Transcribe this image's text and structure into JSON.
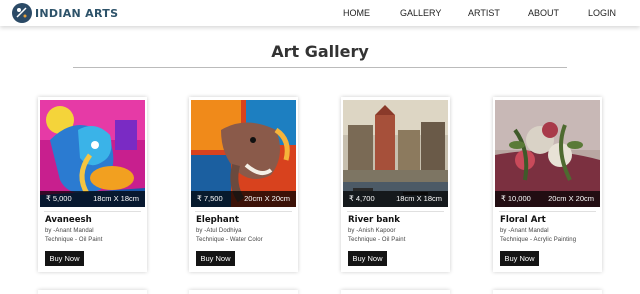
{
  "brand": {
    "name": "INDIAN ARTS",
    "logo_icon": "painter-palette-icon"
  },
  "nav": {
    "items": [
      {
        "label": "HOME"
      },
      {
        "label": "GALLERY"
      },
      {
        "label": "ARTIST"
      },
      {
        "label": "ABOUT"
      },
      {
        "label": "LOGIN"
      }
    ]
  },
  "page": {
    "title": "Art Gallery"
  },
  "cards": [
    {
      "title": "Avaneesh",
      "price": "₹ 5,000",
      "size": "18cm X 18cm",
      "artist": "by -Anant Mandal",
      "technique": "Technique - Oil Paint",
      "button": "Buy Now",
      "image_icon": "ganesha-painting"
    },
    {
      "title": "Elephant",
      "price": "₹ 7,500",
      "size": "20cm X 20cm",
      "artist": "by -Atul Dodhiya",
      "technique": "Technique - Water Color",
      "button": "Buy Now",
      "image_icon": "elephant-painting"
    },
    {
      "title": "River bank",
      "price": "₹ 4,700",
      "size": "18cm X 18cm",
      "artist": "by -Anish Kapoor",
      "technique": "Technique - Oil Paint",
      "button": "Buy Now",
      "image_icon": "river-bank-painting"
    },
    {
      "title": "Floral Art",
      "price": "₹ 10,000",
      "size": "20cm X 20cm",
      "artist": "by -Anant Mandal",
      "technique": "Technique - Acrylic Painting",
      "button": "Buy Now",
      "image_icon": "floral-painting"
    }
  ],
  "colors": {
    "brand": "#2d5269",
    "button_bg": "#141414",
    "price_bar": "#000000"
  }
}
